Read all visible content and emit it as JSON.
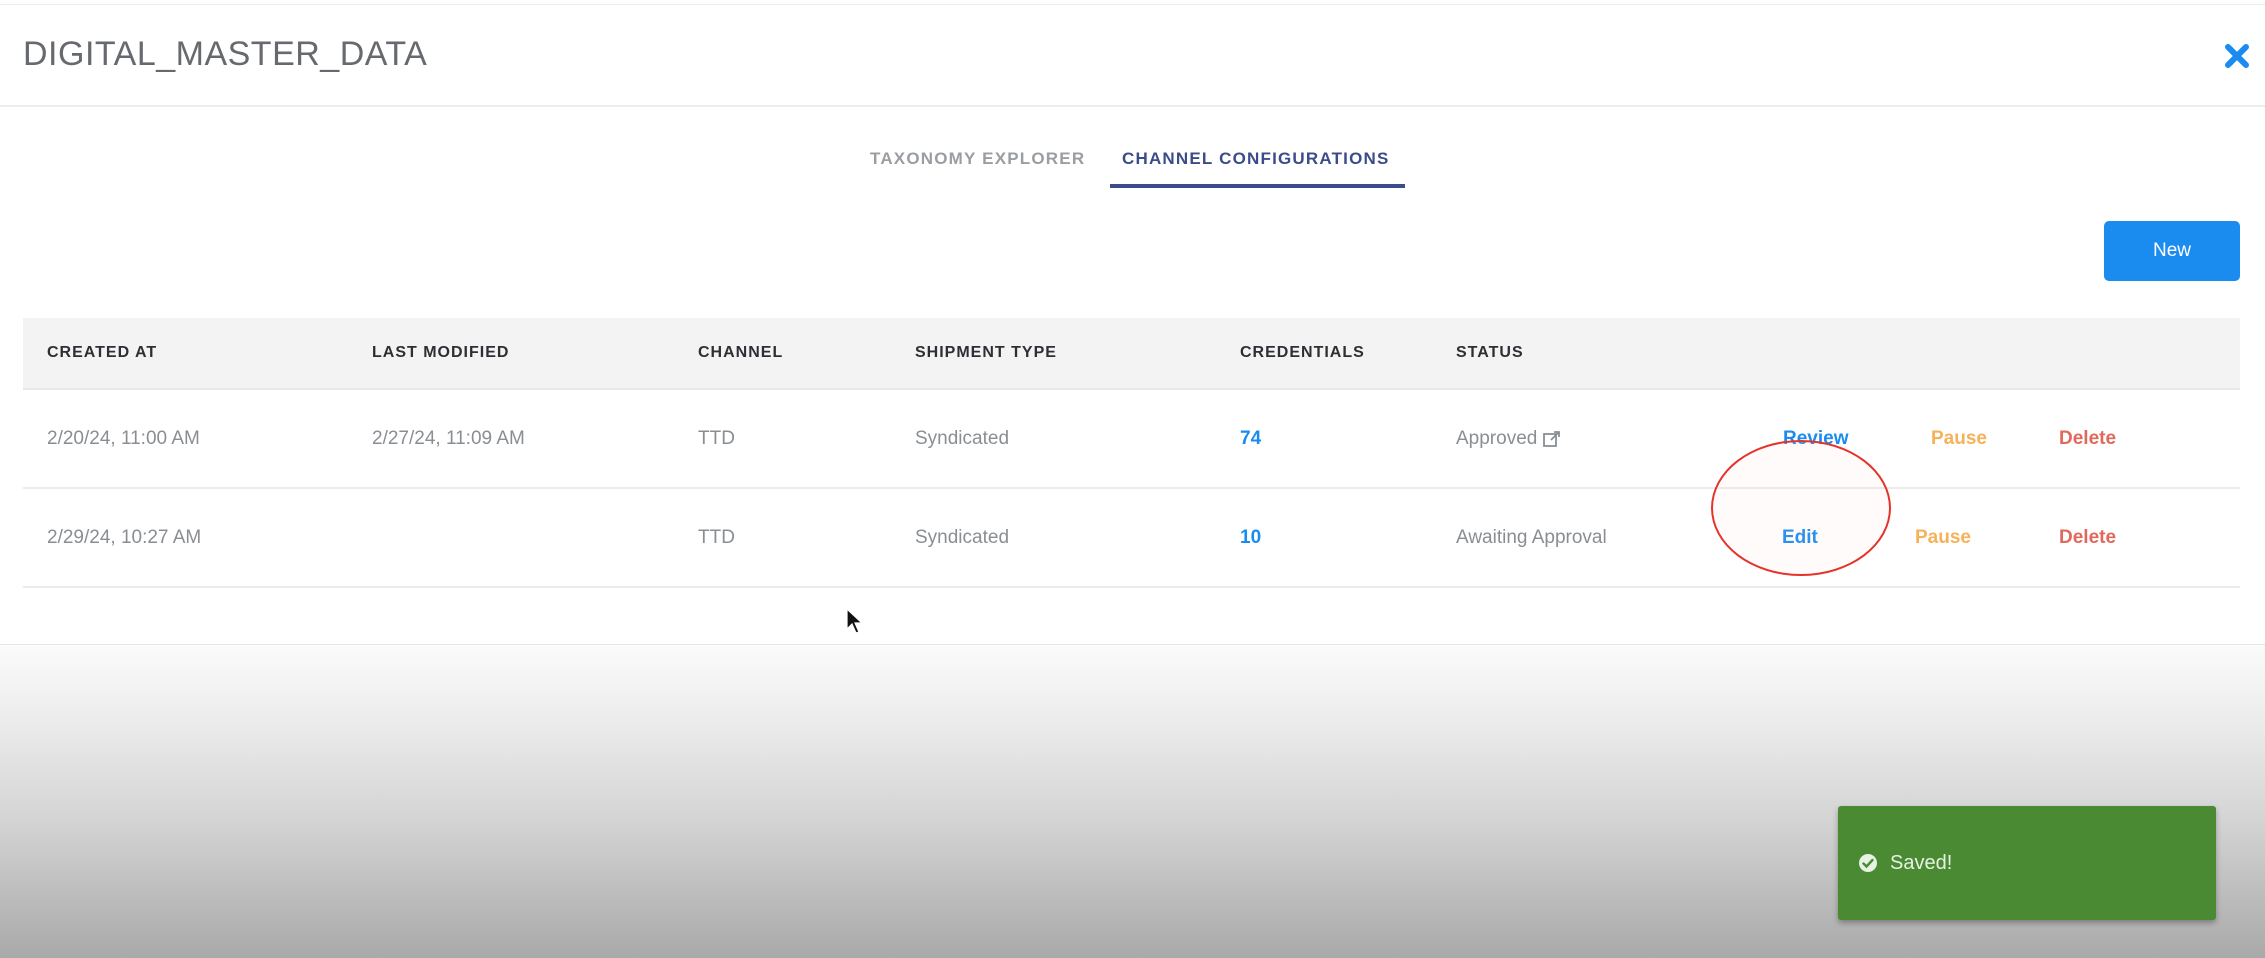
{
  "modal": {
    "title": "DIGITAL_MASTER_DATA",
    "close_icon": "close-icon"
  },
  "tabs": [
    {
      "label": "TAXONOMY EXPLORER",
      "active": false
    },
    {
      "label": "CHANNEL CONFIGURATIONS",
      "active": true
    }
  ],
  "toolbar": {
    "new_label": "New"
  },
  "table": {
    "headers": [
      "CREATED AT",
      "LAST MODIFIED",
      "CHANNEL",
      "SHIPMENT TYPE",
      "CREDENTIALS",
      "STATUS"
    ],
    "rows": [
      {
        "created_at": "2/20/24, 11:00 AM",
        "last_modified": "2/27/24, 11:09 AM",
        "channel": "TTD",
        "shipment_type": "Syndicated",
        "credentials": "74",
        "status": "Approved",
        "status_icon": "external-link-icon",
        "actions": [
          "Review",
          "Pause",
          "Delete"
        ]
      },
      {
        "created_at": "2/29/24, 10:27 AM",
        "last_modified": "",
        "channel": "TTD",
        "shipment_type": "Syndicated",
        "credentials": "10",
        "status": "Awaiting Approval",
        "actions": [
          "Edit",
          "Pause",
          "Delete"
        ]
      }
    ]
  },
  "toast": {
    "text": "Saved!",
    "icon": "check-circle-icon",
    "color": "#4a8a33"
  },
  "colors": {
    "accent": "#1a8cf0",
    "tab_active": "#3b4c8a",
    "pause": "#f5b25a",
    "delete": "#e0685c"
  }
}
